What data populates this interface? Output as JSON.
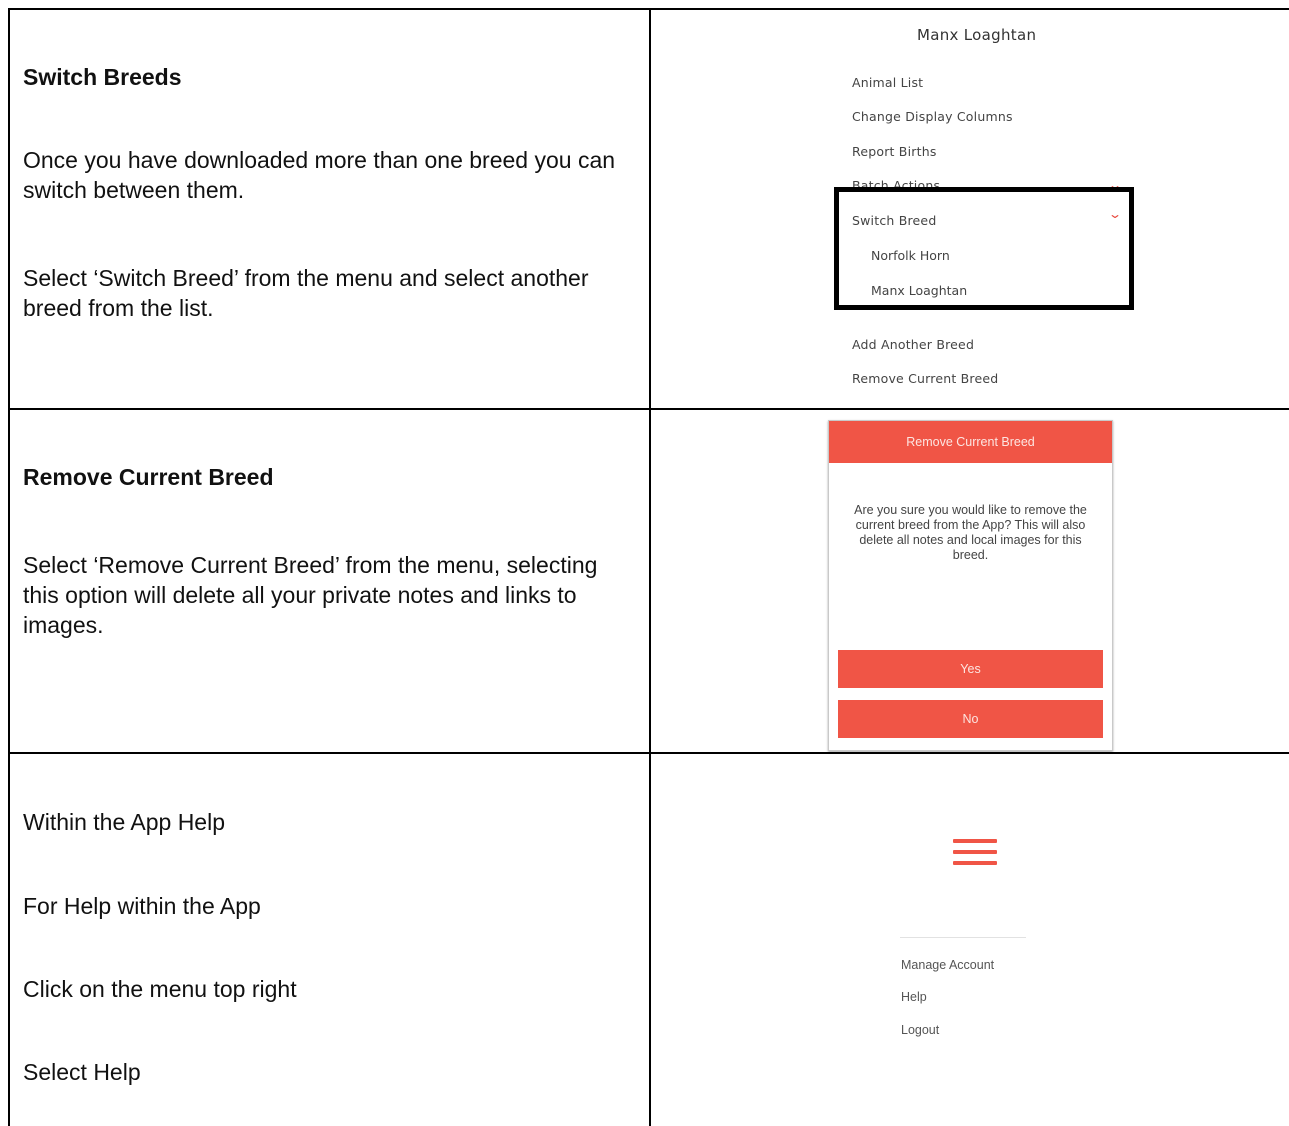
{
  "rows": [
    {
      "heading": "Switch Breeds",
      "paragraphs": [
        "Once you have downloaded more than one breed you can switch between them.",
        "Select ‘Switch Breed’ from the menu and select another breed from the list."
      ],
      "screenshot": {
        "title": "Manx Loaghtan",
        "menu_items": [
          "Animal List",
          "Change Display Columns",
          "Report Births",
          "Batch Actions",
          "Switch Breed"
        ],
        "sub_items": [
          "Norfolk Horn",
          "Manx Loaghtan"
        ],
        "bottom_items": [
          "Add Another Breed",
          "Remove Current Breed"
        ]
      }
    },
    {
      "heading": "Remove Current Breed",
      "paragraphs": [
        "Select ‘Remove Current Breed’ from the menu, selecting this option will delete all your private notes and links to images."
      ],
      "screenshot": {
        "header": "Remove Current Breed",
        "message": "Are you sure you would like to remove the current breed from the App? This will also delete all notes and local images for this breed.",
        "yes": "Yes",
        "no": "No"
      }
    },
    {
      "paragraphs": [
        "Within the App Help",
        "For Help within the App",
        "Click on the menu top right",
        "Select Help"
      ],
      "screenshot": {
        "items": [
          "Manage Account",
          "Help",
          "Logout"
        ]
      }
    }
  ],
  "colors": {
    "accent": "#f05546",
    "border": "#000000"
  },
  "icons": [
    "chevron-down-icon",
    "hamburger-menu-icon"
  ]
}
